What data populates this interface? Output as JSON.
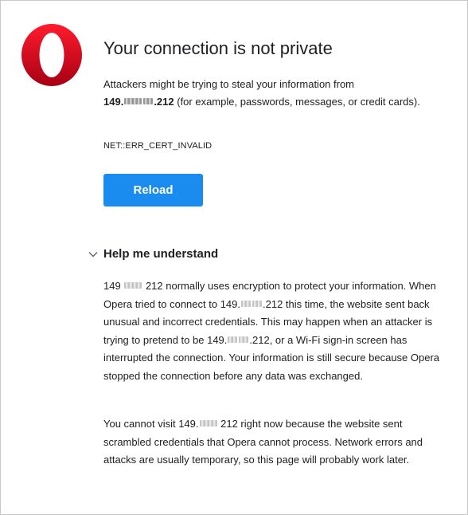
{
  "colors": {
    "accent": "#1a8cf0",
    "logo": "#d11a2a",
    "text": "#202124"
  },
  "logo": {
    "icon": "opera-logo-icon"
  },
  "header": {
    "title": "Your connection is not private"
  },
  "intro": {
    "line1": "Attackers might be trying to steal your information from",
    "ip_prefix": "149.",
    "ip_suffix": ".212",
    "rest": " (for example, passwords, messages, or credit cards)."
  },
  "error_code": "NET::ERR_CERT_INVALID",
  "reload_button": {
    "label": "Reload"
  },
  "help": {
    "icon": "chevron-down-icon",
    "title": "Help me understand",
    "para1": {
      "t1": "149",
      "t2": "212 normally uses encryption to protect your information. When Opera tried to connect to 149.",
      "t3": ".212 this time, the website sent back unusual and incorrect credentials. This may happen when an attacker is trying to pretend to be 149.",
      "t4": ".212, or a Wi-Fi sign-in screen has interrupted the connection. Your information is still secure because Opera stopped the connection before any data was exchanged."
    },
    "para2": {
      "t1": "You cannot visit 149.",
      "t2": "212 right now because the website sent scrambled credentials that Opera cannot process. Network errors and attacks are usually temporary, so this page will probably work later."
    }
  }
}
